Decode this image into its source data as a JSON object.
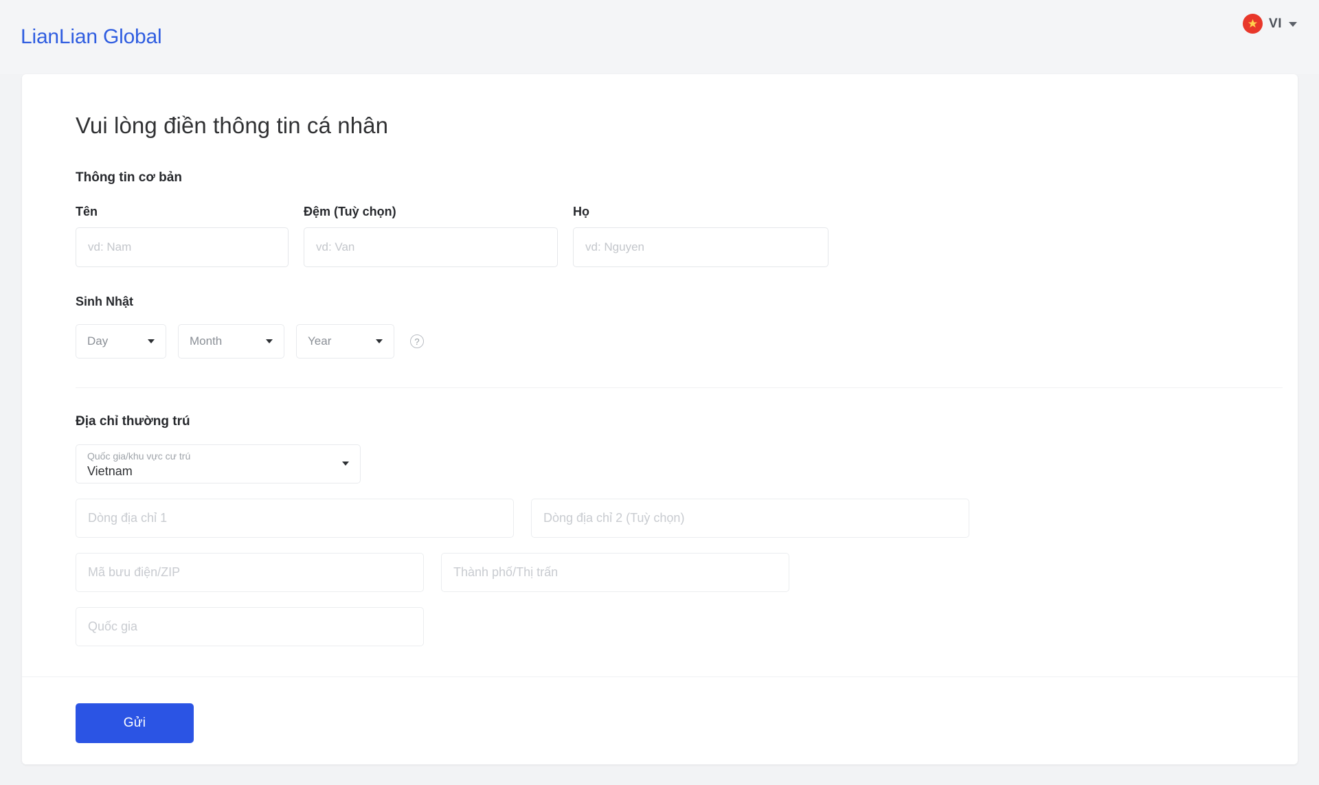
{
  "header": {
    "brand": "LianLian Global",
    "language": {
      "code": "VI",
      "flag_icon": "vietnam-flag-icon",
      "caret_icon": "chevron-down-icon"
    }
  },
  "main": {
    "page_title": "Vui lòng điền thông tin cá nhân",
    "basic_info": {
      "heading": "Thông tin cơ bản",
      "fields": [
        {
          "label": "Tên",
          "placeholder": "vd: Nam",
          "value": ""
        },
        {
          "label": "Đệm (Tuỳ chọn)",
          "placeholder": "vd: Van",
          "value": ""
        },
        {
          "label": "Họ",
          "placeholder": "vd: Nguyen",
          "value": ""
        }
      ]
    },
    "birthday": {
      "heading": "Sinh Nhật",
      "day_label": "Day",
      "month_label": "Month",
      "year_label": "Year",
      "help_icon": "question-mark-circle-icon"
    },
    "address": {
      "heading": "Địa chỉ thường trú",
      "country_select": {
        "label": "Quốc gia/khu vực cư trú",
        "value": "Vietnam"
      },
      "line1_placeholder": "Dòng địa chỉ 1",
      "line2_placeholder": "Dòng địa chỉ 2 (Tuỳ chọn)",
      "zip_placeholder": "Mã bưu điện/ZIP",
      "city_placeholder": "Thành phố/Thị trấn",
      "country_placeholder": "Quốc gia"
    }
  },
  "footer": {
    "submit_label": "Gửi"
  },
  "colors": {
    "brand_blue": "#2f5de0",
    "button_blue": "#2b54e4",
    "flag_red": "#e8372a",
    "page_bg": "#f2f3f5"
  }
}
